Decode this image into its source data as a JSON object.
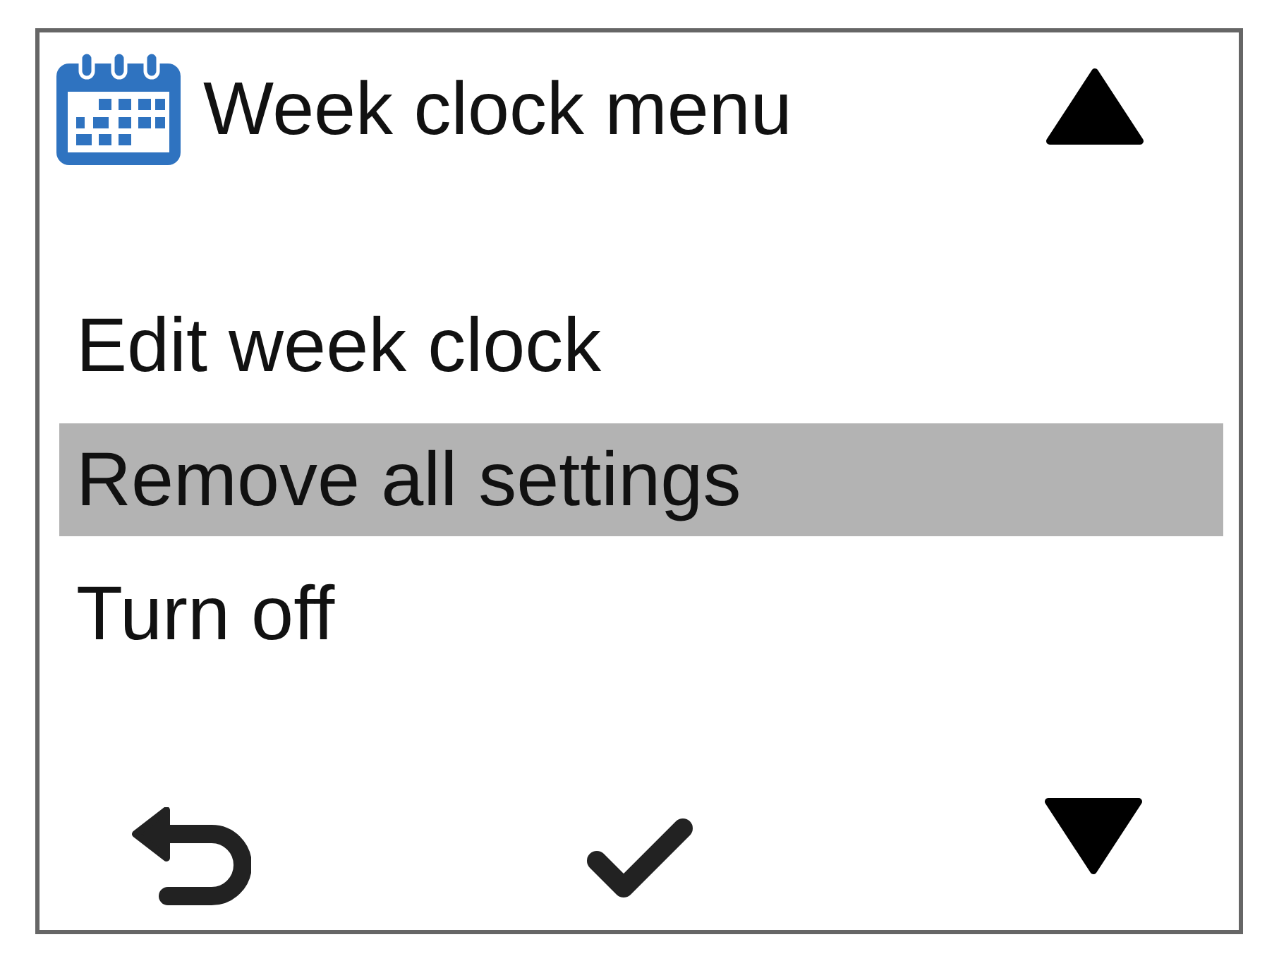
{
  "header": {
    "title": "Week clock menu"
  },
  "menu_items": [
    {
      "label": "Edit week clock",
      "selected": false
    },
    {
      "label": "Remove all settings",
      "selected": true
    },
    {
      "label": "Turn off",
      "selected": false
    }
  ]
}
